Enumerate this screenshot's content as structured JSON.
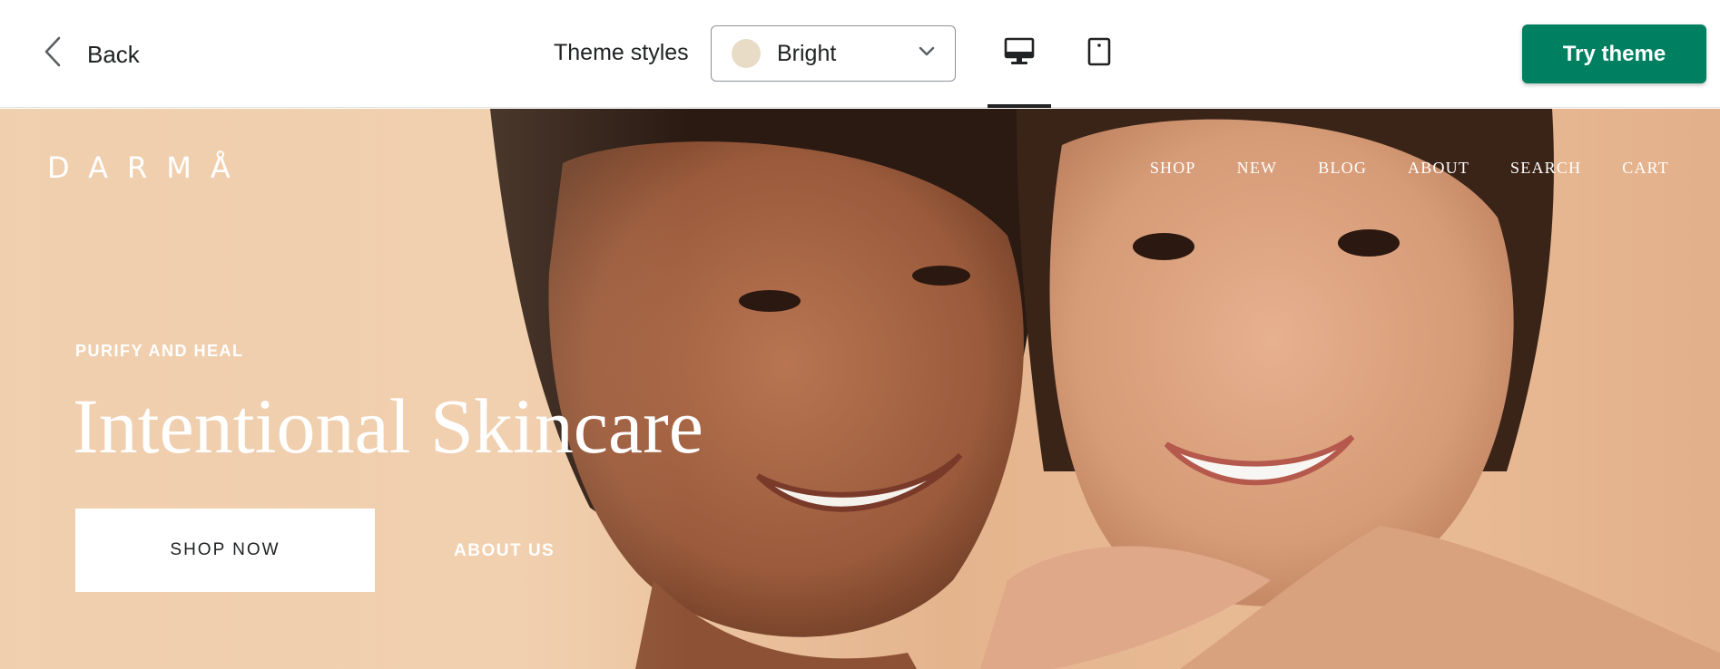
{
  "topbar": {
    "back_label": "Back",
    "theme_styles_label": "Theme styles",
    "selected_style": "Bright",
    "style_swatch_color": "#e8dcc7",
    "active_device": "desktop",
    "try_theme_label": "Try theme",
    "accent_color": "#008060"
  },
  "preview": {
    "brand": "DARMÅ",
    "nav": [
      "SHOP",
      "NEW",
      "BLOG",
      "ABOUT",
      "SEARCH",
      "CART"
    ],
    "eyebrow": "PURIFY AND HEAL",
    "headline": "Intentional Skincare",
    "primary_cta": "SHOP NOW",
    "secondary_cta": "ABOUT US"
  }
}
